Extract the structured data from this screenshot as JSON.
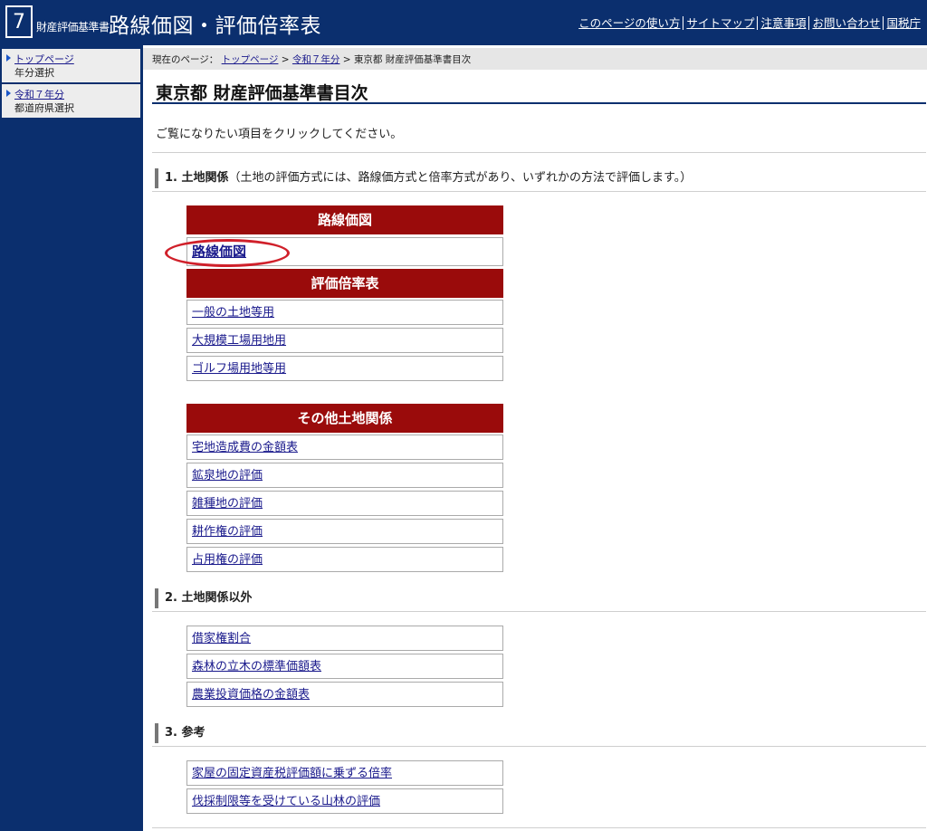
{
  "header": {
    "logo_number": "7",
    "logo_small": "財産評価基準書",
    "logo_big": "路線価図・評価倍率表",
    "nav": [
      "このページの使い方",
      "サイトマップ",
      "注意事項",
      "お問い合わせ",
      "国税庁"
    ]
  },
  "sidebar": {
    "items": [
      {
        "link": "トップページ",
        "sub": "年分選択"
      },
      {
        "link": "令和７年分",
        "sub": "都道府県選択"
      }
    ]
  },
  "breadcrumb": {
    "prefix": "現在のページ：",
    "links": [
      "トップページ",
      "令和７年分"
    ],
    "current": "東京都 財産評価基準書目次",
    "sep": ">"
  },
  "page_title": "東京都 財産評価基準書目次",
  "intro": "ご覧になりたい項目をクリックしてください。",
  "sections": [
    {
      "heading": "1.  土地関係",
      "note": "（土地の評価方式には、路線価方式と倍率方式があり、いずれかの方法で評価します。）"
    },
    {
      "heading": "2.  土地関係以外",
      "note": ""
    },
    {
      "heading": "3.  参考",
      "note": ""
    }
  ],
  "categories": {
    "rosenka": "路線価図",
    "bairitsu": "評価倍率表",
    "other_land": "その他土地関係"
  },
  "links": {
    "rosenka": "路線価図",
    "bairitsu": [
      "一般の土地等用",
      "大規模工場用地用",
      "ゴルフ場用地等用"
    ],
    "other_land": [
      "宅地造成費の金額表",
      "鉱泉地の評価",
      "雑種地の評価",
      "耕作権の評価",
      "占用権の評価"
    ],
    "non_land": [
      "借家権割合",
      "森林の立木の標準価額表",
      "農業投資価格の金額表"
    ],
    "reference": [
      "家屋の固定資産税評価額に乗ずる倍率",
      "伐採制限等を受けている山林の評価"
    ]
  },
  "colors": {
    "header_bg": "#0b2f6e",
    "category_bg": "#9a0b0b",
    "highlight_oval": "#d0202a"
  }
}
